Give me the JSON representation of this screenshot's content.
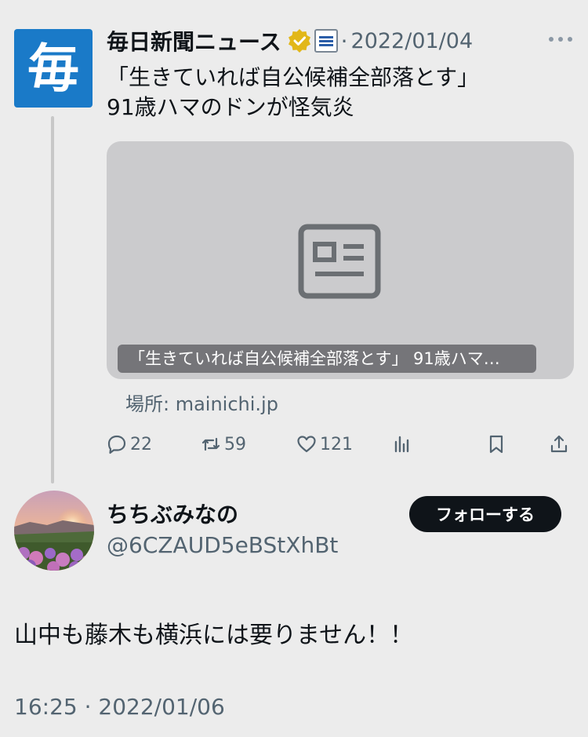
{
  "original_post": {
    "author_name": "毎日新聞ニュース",
    "avatar_glyph": "毎",
    "date": "2022/01/04",
    "separator": "·",
    "text": "「生きていれば自公候補全部落とす」\n91歳ハマのドンが怪気炎",
    "card": {
      "title": "「生きていれば自公候補全部落とす」 91歳ハマ…",
      "icon": "news-article-icon"
    },
    "source": "場所: mainichi.jp",
    "metrics": {
      "replies": "22",
      "reposts": "59",
      "likes": "121"
    }
  },
  "reply": {
    "display_name": "ちちぶみなの",
    "handle": "@6CZAUD5eBStXhBt",
    "follow_label": "フォローする",
    "text": "山中も藤木も横浜には要りません！！",
    "time": "16:25",
    "separator": "·",
    "date": "2022/01/06"
  },
  "colors": {
    "background": "#ececec",
    "brand_blue": "#1a7ac8",
    "secondary_text": "#536471",
    "follow_button": "#0f1419",
    "card_bg": "#cbcbcd"
  }
}
